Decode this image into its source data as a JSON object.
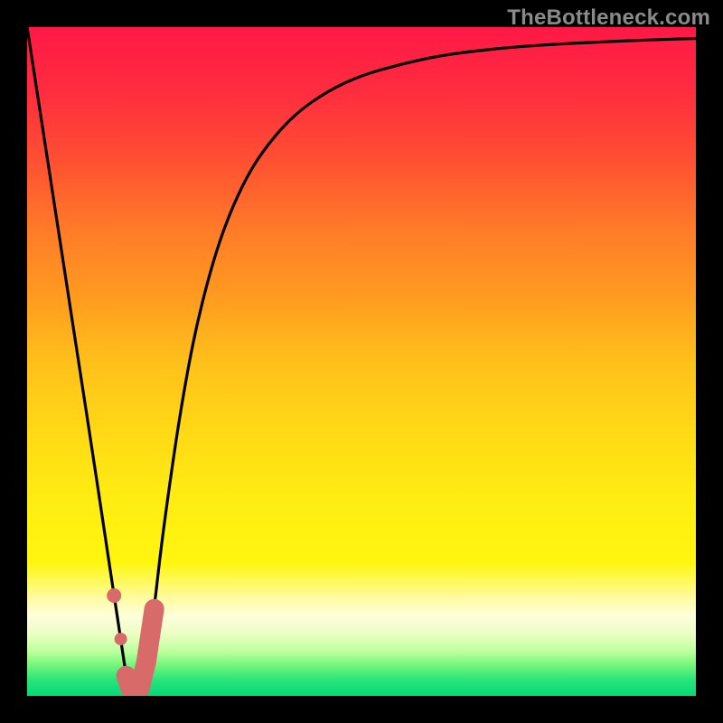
{
  "watermark": "TheBottleneck.com",
  "colors": {
    "black": "#000000",
    "curve": "#000000",
    "marker": "#d96a6a"
  },
  "gradient_stops": [
    {
      "y": 0.0,
      "color": "#ff1846"
    },
    {
      "y": 0.1,
      "color": "#ff2e3e"
    },
    {
      "y": 0.2,
      "color": "#ff5032"
    },
    {
      "y": 0.3,
      "color": "#ff7a28"
    },
    {
      "y": 0.4,
      "color": "#ff9a20"
    },
    {
      "y": 0.5,
      "color": "#ffc01a"
    },
    {
      "y": 0.6,
      "color": "#ffd816"
    },
    {
      "y": 0.7,
      "color": "#ffec12"
    },
    {
      "y": 0.8,
      "color": "#fff60e"
    },
    {
      "y": 0.85,
      "color": "#fffb9a"
    },
    {
      "y": 0.88,
      "color": "#fffedc"
    },
    {
      "y": 0.91,
      "color": "#e8ffc0"
    },
    {
      "y": 0.935,
      "color": "#b8ff9a"
    },
    {
      "y": 0.955,
      "color": "#70f57a"
    },
    {
      "y": 0.975,
      "color": "#2be47a"
    },
    {
      "y": 1.0,
      "color": "#00d878"
    }
  ],
  "chart_data": {
    "type": "line",
    "title": "",
    "xlabel": "",
    "ylabel": "",
    "xlim": [
      0,
      1
    ],
    "ylim": [
      0,
      1
    ],
    "x": [
      0.0,
      0.02,
      0.04,
      0.06,
      0.08,
      0.1,
      0.115,
      0.13,
      0.14,
      0.148,
      0.155,
      0.16,
      0.168,
      0.178,
      0.19,
      0.2,
      0.215,
      0.23,
      0.25,
      0.275,
      0.3,
      0.33,
      0.36,
      0.4,
      0.45,
      0.5,
      0.56,
      0.62,
      0.7,
      0.78,
      0.86,
      0.93,
      1.0
    ],
    "series": [
      {
        "name": "bottleneck-curve",
        "values": [
          1.0,
          0.87,
          0.74,
          0.61,
          0.48,
          0.35,
          0.25,
          0.15,
          0.085,
          0.03,
          0.01,
          0.0,
          0.01,
          0.05,
          0.13,
          0.22,
          0.33,
          0.43,
          0.54,
          0.64,
          0.715,
          0.78,
          0.825,
          0.87,
          0.905,
          0.928,
          0.945,
          0.958,
          0.968,
          0.974,
          0.978,
          0.981,
          0.983
        ]
      }
    ],
    "markers": {
      "type": "curve-segment",
      "x": [
        0.13,
        0.14,
        0.148,
        0.155,
        0.16,
        0.168,
        0.178,
        0.19
      ],
      "values": [
        0.15,
        0.085,
        0.03,
        0.01,
        0.0,
        0.01,
        0.05,
        0.13
      ],
      "color": "#d96a6a"
    }
  }
}
